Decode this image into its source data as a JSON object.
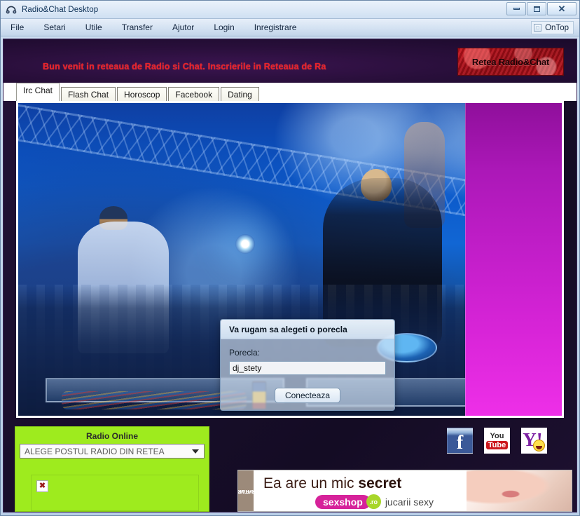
{
  "window": {
    "title": "Radio&Chat Desktop",
    "icon": "headphones-icon",
    "buttons": {
      "minimize": "minimize-icon",
      "maximize": "maximize-icon",
      "close": "close-icon"
    }
  },
  "menubar": {
    "items": [
      "File",
      "Setari",
      "Utile",
      "Transfer",
      "Ajutor",
      "Login",
      "Inregistrare"
    ],
    "ontop_label": "OnTop",
    "ontop_checked": false
  },
  "banner": {
    "marquee": "Bun venit in reteaua de Radio si Chat. Inscrierile in Reteaua de Ra",
    "logo_text": "Retea Radio&Chat"
  },
  "tabs": [
    {
      "label": "Irc Chat",
      "active": true
    },
    {
      "label": "Flash Chat",
      "active": false
    },
    {
      "label": "Horoscop",
      "active": false
    },
    {
      "label": "Facebook",
      "active": false
    },
    {
      "label": "Dating",
      "active": false
    }
  ],
  "dialog": {
    "title": "Va rugam sa alegeti o porecla",
    "field_label": "Porecla:",
    "field_value": "dj_stety",
    "field_placeholder": "",
    "submit_label": "Conecteaza"
  },
  "radio_panel": {
    "title": "Radio Online",
    "select_value": "ALEGE POSTUL RADIO DIN RETEA",
    "broken_image_glyph": "✖"
  },
  "social": [
    {
      "name": "facebook",
      "letter": "f"
    },
    {
      "name": "youtube",
      "top": "You",
      "bottom": "Tube"
    },
    {
      "name": "yahoo-messenger",
      "letter": "Y!"
    }
  ],
  "ad": {
    "strip_line1": "LIVRARE",
    "strip_line2": "GRATUITA",
    "headline_plain": "Ea are un mic ",
    "headline_bold": "secret",
    "brand": "sexshop",
    "tld": ".ro",
    "tagline": "jucarii sexy"
  },
  "colors": {
    "app_background": "#1a0f2e",
    "marquee_red": "#e8222a",
    "radio_green": "#9eeb1e",
    "pink_panel_top": "#8f0f9b",
    "pink_panel_bottom": "#ee2fe8",
    "ad_pink": "#d6229a"
  }
}
